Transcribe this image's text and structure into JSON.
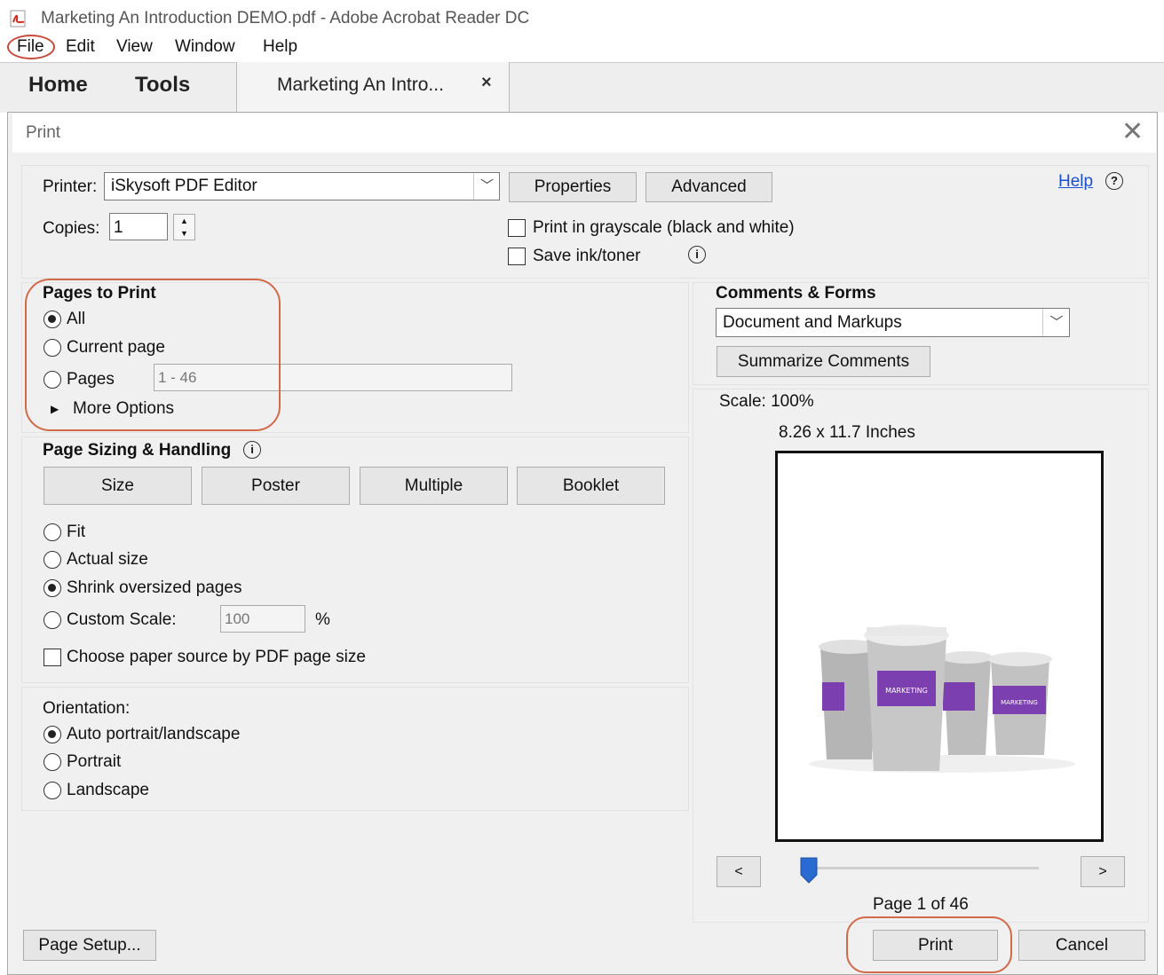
{
  "window": {
    "title": "Marketing An Introduction DEMO.pdf - Adobe Acrobat Reader DC"
  },
  "menubar": {
    "items": [
      "File",
      "Edit",
      "View",
      "Window",
      "Help"
    ]
  },
  "tabs": {
    "home": "Home",
    "tools": "Tools",
    "document": "Marketing An Intro...",
    "close": "×"
  },
  "dialog": {
    "title": "Print",
    "close": "✕",
    "printer_label": "Printer:",
    "printer_value": "iSkysoft PDF Editor",
    "properties": "Properties",
    "advanced": "Advanced",
    "help": "Help",
    "copies_label": "Copies:",
    "copies_value": "1",
    "grayscale": "Print in grayscale (black and white)",
    "save_ink": "Save ink/toner",
    "pages_to_print": {
      "heading": "Pages to Print",
      "all": "All",
      "current_page": "Current page",
      "pages": "Pages",
      "pages_range": "1 - 46",
      "more_options": "More Options",
      "selected": "All"
    },
    "page_sizing": {
      "heading": "Page Sizing & Handling",
      "tabs": [
        "Size",
        "Poster",
        "Multiple",
        "Booklet"
      ],
      "fit": "Fit",
      "actual_size": "Actual size",
      "shrink": "Shrink oversized pages",
      "custom_scale": "Custom Scale:",
      "custom_scale_value": "100",
      "percent": "%",
      "paper_source": "Choose paper source by PDF page size",
      "selected": "Shrink oversized pages"
    },
    "orientation": {
      "heading": "Orientation:",
      "auto": "Auto portrait/landscape",
      "portrait": "Portrait",
      "landscape": "Landscape",
      "selected": "Auto portrait/landscape"
    },
    "comments_forms": {
      "heading": "Comments & Forms",
      "value": "Document and Markups",
      "summarize": "Summarize Comments"
    },
    "preview": {
      "scale": "Scale: 100%",
      "size": "8.26 x 11.7 Inches",
      "prev": "<",
      "next": ">",
      "page_info": "Page 1 of 46",
      "cup_label": "MARKETING"
    },
    "page_setup": "Page Setup...",
    "print": "Print",
    "cancel": "Cancel"
  },
  "colors": {
    "highlight_oval": "#d06a48",
    "cup_band": "#7b3fb0",
    "slider_thumb": "#2a6bd1"
  }
}
